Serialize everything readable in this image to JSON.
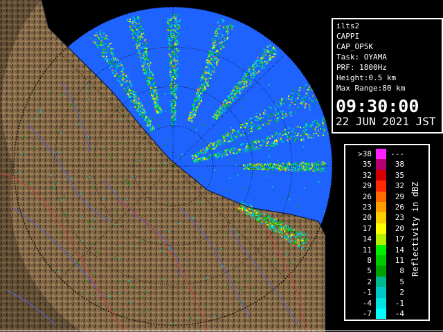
{
  "info": {
    "radar_name": "ilts2",
    "product": "CAPPI",
    "scan": "CAP_OP5K",
    "task": "Task: OYAMA",
    "prf": "PRF: 1800Hz",
    "height": "Height:0.5 km",
    "max_range": "Max Range:80 km",
    "time": "09:30:00",
    "date": "22 JUN 2021 JST"
  },
  "legend": {
    "title": "Reflectivity in dBZ",
    "rows": [
      {
        "lo": ">38",
        "hi": "---",
        "color": "#ff20ff"
      },
      {
        "lo": "35",
        "hi": "38",
        "color": "#b4006e"
      },
      {
        "lo": "32",
        "hi": "35",
        "color": "#d40000"
      },
      {
        "lo": "29",
        "hi": "32",
        "color": "#ff2800"
      },
      {
        "lo": "26",
        "hi": "29",
        "color": "#ff6a00"
      },
      {
        "lo": "23",
        "hi": "26",
        "color": "#ffa000"
      },
      {
        "lo": "20",
        "hi": "23",
        "color": "#ffd000"
      },
      {
        "lo": "17",
        "hi": "20",
        "color": "#ffff00"
      },
      {
        "lo": "14",
        "hi": "17",
        "color": "#b4f000"
      },
      {
        "lo": "11",
        "hi": "14",
        "color": "#00f000"
      },
      {
        "lo": "8",
        "hi": "11",
        "color": "#00c800"
      },
      {
        "lo": "5",
        "hi": "8",
        "color": "#00a000"
      },
      {
        "lo": "2",
        "hi": "5",
        "color": "#00b890"
      },
      {
        "lo": "-1",
        "hi": "2",
        "color": "#00c8c8"
      },
      {
        "lo": "-4",
        "hi": "-1",
        "color": "#00e4e4"
      },
      {
        "lo": "-7",
        "hi": "-4",
        "color": "#00ffff"
      }
    ]
  },
  "colors": {
    "land": "#8a6e4b",
    "land_dark": "#4a3a26",
    "sea_coverage": "#1f63ff",
    "sea_edge": "#1a4fd8",
    "outside": "#000000",
    "rivers": "#5060d8",
    "borders": "#d04040",
    "range_rings": "#000000"
  }
}
